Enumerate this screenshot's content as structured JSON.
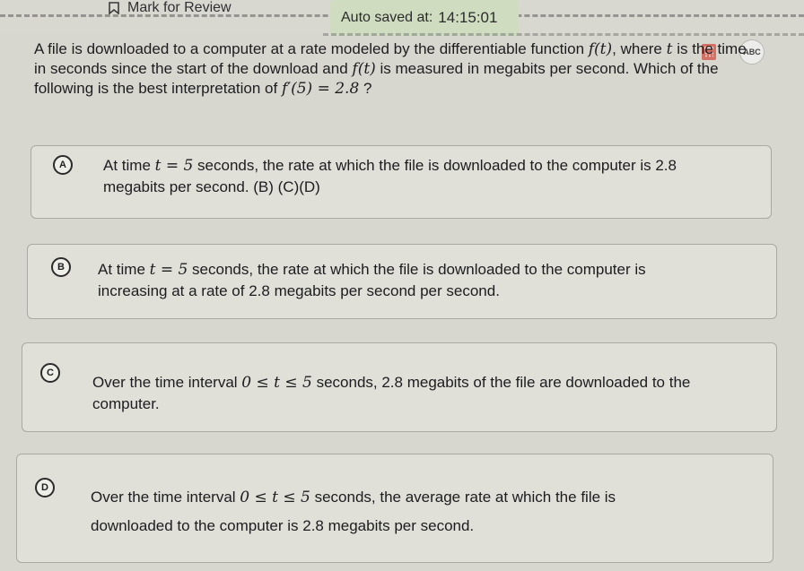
{
  "header": {
    "mark_for_review": "Mark for Review",
    "autosave_label": "Auto saved at:",
    "autosave_time": "14:15:01",
    "tools": {
      "calculator_icon": "calculator-icon",
      "abc_icon": "abc-icon",
      "abc_text": "ABC"
    }
  },
  "question": {
    "line1a": "A file is downloaded to a computer at a rate modeled by the differentiable function ",
    "line1_func": "f(t)",
    "line1b": ", where ",
    "line1_var": "t",
    "line1c": " is the time",
    "line2a": "in seconds since the start of the download and ",
    "line2_func": "f(t)",
    "line2b": " is measured in megabits per second. Which of the",
    "line3a": "following is the best interpretation of ",
    "line3_math": "f′(5) = 2.8",
    "line3b": " ?"
  },
  "choices": [
    {
      "letter": "A",
      "line1a": "At time ",
      "line1_math": "t = 5",
      "line1b": " seconds, the rate at which the file is downloaded to the computer is 2.8",
      "line2": "megabits per second. (B) (C)(D)"
    },
    {
      "letter": "B",
      "line1a": "At time ",
      "line1_math": "t = 5",
      "line1b": " seconds, the rate at which the file is downloaded to the computer is",
      "line2": "increasing at a rate of 2.8 megabits per second per second."
    },
    {
      "letter": "C",
      "line1a": "Over the time interval ",
      "line1_math": "0 ≤ t ≤ 5",
      "line1b": " seconds, 2.8 megabits of the file are downloaded to the",
      "line2": "computer."
    },
    {
      "letter": "D",
      "line1a": "Over the time interval ",
      "line1_math": "0 ≤ t ≤ 5",
      "line1b": " seconds, the average rate at which the file is",
      "line2": "downloaded to the computer is 2.8 megabits per second."
    }
  ]
}
